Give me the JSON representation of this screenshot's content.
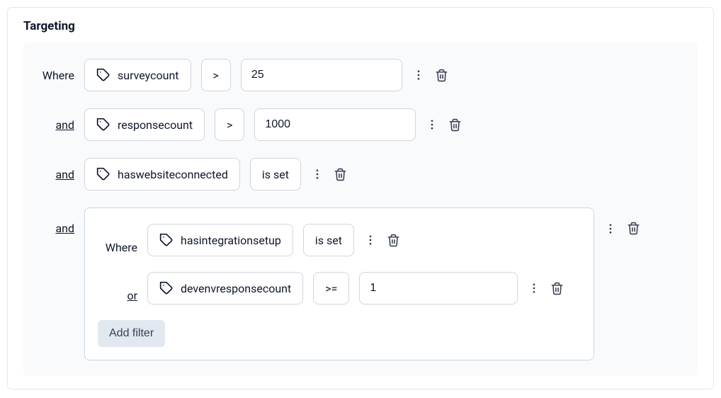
{
  "title": "Targeting",
  "rows": [
    {
      "prefix": "Where",
      "prefixLink": false,
      "tag": "surveycount",
      "op": ">",
      "value": "25"
    },
    {
      "prefix": "and",
      "prefixLink": true,
      "tag": "responsecount",
      "op": ">",
      "value": "1000"
    },
    {
      "prefix": "and",
      "prefixLink": true,
      "tag": "haswebsiteconnected",
      "op": "is set"
    }
  ],
  "nestedPrefix": "and",
  "nested": {
    "rows": [
      {
        "prefix": "Where",
        "prefixLink": false,
        "tag": "hasintegrationsetup",
        "op": "is set"
      },
      {
        "prefix": "or",
        "prefixLink": true,
        "tag": "devenvresponsecount",
        "op": ">=",
        "value": "1"
      }
    ],
    "addFilterLabel": "Add filter"
  }
}
